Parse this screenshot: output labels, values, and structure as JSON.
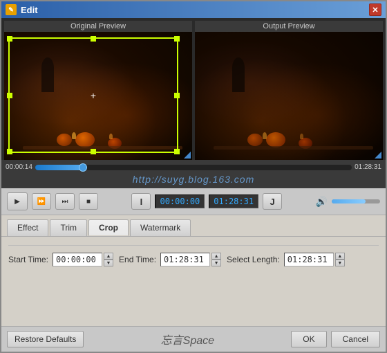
{
  "window": {
    "title": "Edit",
    "icon": "✎"
  },
  "preview": {
    "original_label": "Original Preview",
    "output_label": "Output Preview"
  },
  "timeline": {
    "start_time": "00:00:14",
    "end_time": "01:28:31",
    "fill_percent": 15
  },
  "watermark": {
    "text": "http://suyg.blog.163.com"
  },
  "playback": {
    "current_time": "00:00:00",
    "total_time": "01:28:31"
  },
  "tabs": [
    {
      "id": "effect",
      "label": "Effect"
    },
    {
      "id": "trim",
      "label": "Trim"
    },
    {
      "id": "crop",
      "label": "Crop"
    },
    {
      "id": "watermark",
      "label": "Watermark"
    }
  ],
  "fields": {
    "start_time_label": "Start Time:",
    "start_time_value": "00:00:00",
    "end_time_label": "End Time:",
    "end_time_value": "01:28:31",
    "select_length_label": "Select Length:",
    "select_length_value": "01:28:31"
  },
  "buttons": {
    "restore_defaults": "Restore Defaults",
    "ok": "OK",
    "cancel": "Cancel"
  },
  "brand": {
    "text": "忘言Space"
  }
}
